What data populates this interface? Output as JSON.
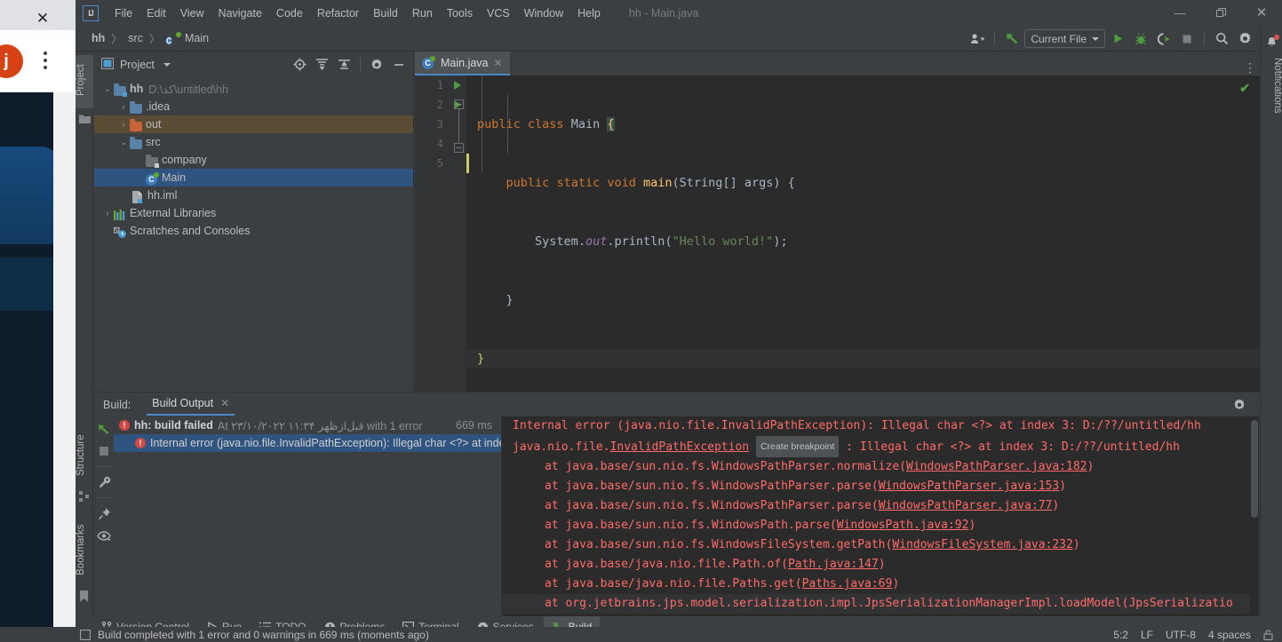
{
  "window": {
    "title": "hh - Main.java",
    "controls": {
      "minimize": "—",
      "maximize": "❐",
      "close": "✕"
    }
  },
  "menubar": {
    "logo": "IJ",
    "items": [
      {
        "label": "File"
      },
      {
        "label": "Edit"
      },
      {
        "label": "View"
      },
      {
        "label": "Navigate"
      },
      {
        "label": "Code"
      },
      {
        "label": "Refactor"
      },
      {
        "label": "Build"
      },
      {
        "label": "Run"
      },
      {
        "label": "Tools"
      },
      {
        "label": "VCS"
      },
      {
        "label": "Window"
      },
      {
        "label": "Help"
      }
    ]
  },
  "navbar": {
    "crumbs": [
      {
        "label": "hh",
        "bold": true
      },
      {
        "label": "src",
        "bold": false
      },
      {
        "label": "Main",
        "bold": false
      }
    ],
    "separator": "〉",
    "run_config": "Current File",
    "buttons": {
      "profile": "profile-icon",
      "update": "update-project-icon",
      "run": "run-icon",
      "debug": "debug-icon",
      "run_coverage": "run-with-coverage-icon",
      "stop": "stop-icon",
      "search": "search-everywhere-icon",
      "settings": "settings-icon",
      "ai": "ai-assistant-icon"
    }
  },
  "left_strip": {
    "tabs": [
      "Project",
      "Structure",
      "Bookmarks"
    ]
  },
  "project_panel": {
    "title": "Project",
    "header_buttons": [
      "select-opened-file-icon",
      "expand-all-icon",
      "collapse-all-icon",
      "settings-icon",
      "hide-icon"
    ],
    "tree": [
      {
        "label": "hh",
        "path": "D:\\کد\\untitled\\hh",
        "icon": "module-folder-icon",
        "twist": "⌄",
        "indent": 0,
        "state": "normal",
        "bold": true
      },
      {
        "label": ".idea",
        "path": "",
        "icon": "folder-icon",
        "twist": "›",
        "indent": 1,
        "state": "normal",
        "bold": false
      },
      {
        "label": "out",
        "path": "",
        "icon": "excluded-folder-icon",
        "twist": "›",
        "indent": 1,
        "state": "hover",
        "bold": false
      },
      {
        "label": "src",
        "path": "",
        "icon": "source-folder-icon",
        "twist": "⌄",
        "indent": 1,
        "state": "normal",
        "bold": false
      },
      {
        "label": "company",
        "path": "",
        "icon": "package-folder-icon",
        "twist": "",
        "indent": 2,
        "state": "normal",
        "bold": false
      },
      {
        "label": "Main",
        "path": "",
        "icon": "java-class-icon",
        "twist": "",
        "indent": 2,
        "state": "selected",
        "bold": false
      },
      {
        "label": "hh.iml",
        "path": "",
        "icon": "iml-file-icon",
        "twist": "",
        "indent": 1,
        "state": "normal",
        "bold": false
      },
      {
        "label": "External Libraries",
        "path": "",
        "icon": "libraries-icon",
        "twist": "›",
        "indent": 0,
        "state": "normal",
        "bold": false
      },
      {
        "label": "Scratches and Consoles",
        "path": "",
        "icon": "scratches-icon",
        "twist": "",
        "indent": 0,
        "state": "normal",
        "bold": false
      }
    ]
  },
  "editor": {
    "tab": {
      "label": "Main.java",
      "icon": "java-class-icon",
      "close": "✕"
    },
    "more_icon": "⋮",
    "inspection_status": "✔",
    "lines": [
      {
        "num": "1",
        "runnable": true,
        "fold": "",
        "current": false
      },
      {
        "num": "2",
        "runnable": true,
        "fold": "−",
        "current": false
      },
      {
        "num": "3",
        "runnable": false,
        "fold": "",
        "current": false
      },
      {
        "num": "4",
        "runnable": false,
        "fold": "−",
        "current": false
      },
      {
        "num": "5",
        "runnable": false,
        "fold": "",
        "current": true
      }
    ],
    "code_text": [
      "public class Main {",
      "    public static void main(String[] args) {",
      "        System.out.println(\"Hello world!\");",
      "    }",
      "}"
    ]
  },
  "build_panel": {
    "label": "Build:",
    "tab": {
      "label": "Build Output",
      "close": "✕"
    },
    "header_buttons": [
      "settings-icon",
      "hide-icon"
    ],
    "side_buttons": [
      "rerun-icon",
      "stop-icon",
      "build-settings-icon",
      "pin-icon",
      "eye-icon"
    ],
    "tree": [
      {
        "title": "hh: build failed",
        "subtitle": "At ۲۳/۱۰/۲۰۲۲ ۱۱:۳۴ قبل‌ازظهر with 1 error",
        "duration": "669 ms",
        "selected": false,
        "indent": 0
      },
      {
        "title": "Internal error (java.nio.file.InvalidPathException): Illegal char <?> at index",
        "subtitle": "",
        "duration": "",
        "selected": true,
        "indent": 1
      }
    ],
    "console_lines": [
      {
        "text": "Internal error (java.nio.file.InvalidPathException): Illegal char <?> at index 3: D:/??/untitled/hh",
        "indent": false,
        "last": false
      },
      {
        "text": "java.nio.file.InvalidPathException : Illegal char <?> at index 3: D:/??/untitled/hh",
        "link": "InvalidPathException",
        "badge": "Create breakpoint",
        "indent": false,
        "last": false
      },
      {
        "text": "at java.base/sun.nio.fs.WindowsPathParser.normalize(WindowsPathParser.java:182)",
        "link": "WindowsPathParser.java:182",
        "indent": true,
        "last": false
      },
      {
        "text": "at java.base/sun.nio.fs.WindowsPathParser.parse(WindowsPathParser.java:153)",
        "link": "WindowsPathParser.java:153",
        "indent": true,
        "last": false
      },
      {
        "text": "at java.base/sun.nio.fs.WindowsPathParser.parse(WindowsPathParser.java:77)",
        "link": "WindowsPathParser.java:77",
        "indent": true,
        "last": false
      },
      {
        "text": "at java.base/sun.nio.fs.WindowsPath.parse(WindowsPath.java:92)",
        "link": "WindowsPath.java:92",
        "indent": true,
        "last": false
      },
      {
        "text": "at java.base/sun.nio.fs.WindowsFileSystem.getPath(WindowsFileSystem.java:232)",
        "link": "WindowsFileSystem.java:232",
        "indent": true,
        "last": false
      },
      {
        "text": "at java.base/java.nio.file.Path.of(Path.java:147)",
        "link": "Path.java:147",
        "indent": true,
        "last": false
      },
      {
        "text": "at java.base/java.nio.file.Paths.get(Paths.java:69)",
        "link": "Paths.java:69",
        "indent": true,
        "last": false
      },
      {
        "text": "at org.jetbrains.jps.model.serialization.impl.JpsSerializationManagerImpl.loadModel(JpsSerializatio",
        "link": "",
        "indent": true,
        "last": true
      }
    ],
    "console_right_buttons": [
      "soft-wrap-icon",
      "scroll-to-end-icon"
    ]
  },
  "bottom_bar": {
    "items": [
      {
        "label": "Version Control",
        "icon": "branch-icon",
        "active": false
      },
      {
        "label": "Run",
        "icon": "run-icon",
        "active": false
      },
      {
        "label": "TODO",
        "icon": "todo-icon",
        "active": false
      },
      {
        "label": "Problems",
        "icon": "problems-icon",
        "active": false
      },
      {
        "label": "Terminal",
        "icon": "terminal-icon",
        "active": false
      },
      {
        "label": "Services",
        "icon": "services-icon",
        "active": false
      },
      {
        "label": "Build",
        "icon": "build-icon",
        "active": true
      }
    ]
  },
  "status_bar": {
    "message": "Build completed with 1 error and 0 warnings in 669 ms (moments ago)",
    "caret": "5:2",
    "line_sep": "LF",
    "encoding": "UTF-8",
    "indent": "4 spaces",
    "lock_icon": "🔓"
  },
  "right_strip": {
    "label": "Notifications",
    "icon": "bell-icon",
    "has_badge": true
  },
  "background_window": {
    "close": "✕",
    "avatar_letter": "j",
    "kebab": "kebab-menu-icon"
  },
  "colors": {
    "accent_blue": "#4a88c7",
    "selection_blue": "#2f5480",
    "error_red": "#cf4a45",
    "console_red": "#ff6b68",
    "keyword_orange": "#cc7832",
    "string_green": "#6a8759",
    "method_yellow": "#ffc66d",
    "field_purple": "#9876aa",
    "panel_bg": "#3c3f41",
    "editor_bg": "#2b2b2b"
  }
}
